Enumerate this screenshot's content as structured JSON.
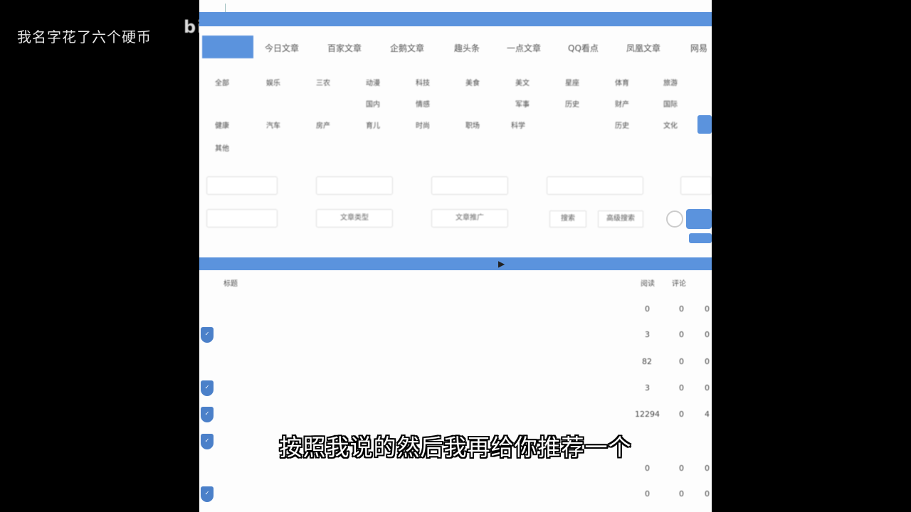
{
  "overlay": {
    "watermark_text": "我名字花了六个硬币",
    "logo_text": "bili",
    "subtitle": "按照我说的然后我再给你推荐一个"
  },
  "tabs": [
    {
      "label": "",
      "active": true
    },
    {
      "label": "今日文章",
      "active": false
    },
    {
      "label": "百家文章",
      "active": false
    },
    {
      "label": "企鹅文章",
      "active": false
    },
    {
      "label": "趣头条",
      "active": false
    },
    {
      "label": "一点文章",
      "active": false
    },
    {
      "label": "QQ看点",
      "active": false
    },
    {
      "label": "凤凰文章",
      "active": false
    },
    {
      "label": "网易",
      "active": false
    }
  ],
  "categories": [
    [
      "全部",
      "娱乐",
      "三农",
      "动漫",
      "科技",
      "美食",
      "美文",
      "星座",
      "体育",
      "旅游"
    ],
    [
      "",
      "",
      "",
      "国内",
      "情感",
      "",
      "军事",
      "历史",
      "财产",
      "国际"
    ],
    [
      "健康",
      "汽车",
      "房产",
      "育儿",
      "时尚",
      "职场",
      "科学",
      "",
      "历史",
      "文化"
    ],
    [
      "其他"
    ]
  ],
  "filters": {
    "row1": [
      "",
      "",
      "",
      "",
      ""
    ],
    "row2": [
      "",
      "文章类型",
      "文章推广",
      "搜索",
      "高级搜索"
    ]
  },
  "table": {
    "headers": [
      "",
      "标题",
      "阅读",
      "评论",
      ""
    ],
    "rows": [
      {
        "title": "",
        "v1": "0",
        "v2": "0",
        "v3": "0",
        "badge": false
      },
      {
        "title": "",
        "v1": "3",
        "v2": "0",
        "v3": "0",
        "badge": true
      },
      {
        "title": "",
        "v1": "82",
        "v2": "0",
        "v3": "0",
        "badge": false
      },
      {
        "title": "",
        "v1": "3",
        "v2": "0",
        "v3": "0",
        "badge": true
      },
      {
        "title": "",
        "v1": "12294",
        "v2": "0",
        "v3": "4",
        "badge": true
      },
      {
        "title": "",
        "v1": "",
        "v2": "",
        "v3": "",
        "badge": true
      },
      {
        "title": "",
        "v1": "0",
        "v2": "0",
        "v3": "0",
        "badge": false
      },
      {
        "title": "",
        "v1": "0",
        "v2": "0",
        "v3": "0",
        "badge": true
      }
    ]
  }
}
